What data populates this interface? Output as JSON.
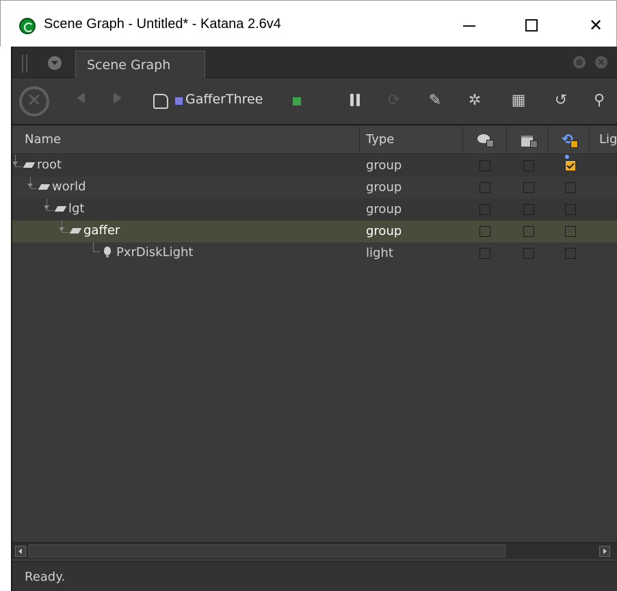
{
  "window": {
    "title": "Scene Graph - Untitled* - Katana 2.6v4",
    "minimize_icon": "minimize-icon",
    "maximize_icon": "maximize-icon",
    "close_glyph": "✕"
  },
  "panel": {
    "tab_label": "Scene Graph"
  },
  "toolbar": {
    "node_name": "GafferThree",
    "stop_glyph": "✕",
    "icons": [
      "stop-icon",
      "back-icon",
      "forward-icon",
      "document-icon",
      "pause-icon",
      "refresh-icon",
      "brush-icon",
      "gear-icon",
      "clapper-icon",
      "rotate-icon",
      "search-icon"
    ],
    "glyphs": {
      "refresh": "⟳",
      "brush": "✎",
      "gear": "✲",
      "clap": "▦",
      "rotate": "↺",
      "search": "⚲"
    }
  },
  "table": {
    "columns": {
      "name": "Name",
      "type": "Type",
      "last": "Lig"
    },
    "rows": [
      {
        "name": "root",
        "type": "group",
        "visible": false,
        "render": false,
        "lock": true,
        "selected": false
      },
      {
        "name": "world",
        "type": "group",
        "visible": false,
        "render": false,
        "lock": false,
        "selected": false
      },
      {
        "name": "lgt",
        "type": "group",
        "visible": false,
        "render": false,
        "lock": false,
        "selected": false
      },
      {
        "name": "gaffer",
        "type": "group",
        "visible": false,
        "render": false,
        "lock": false,
        "selected": true
      },
      {
        "name": "PxrDiskLight",
        "type": "light",
        "visible": false,
        "render": false,
        "lock": false,
        "selected": false
      }
    ]
  },
  "status": {
    "text": "Ready."
  },
  "colors": {
    "panel_bg": "#3a3a3a",
    "selected_row": "#4b4b3c",
    "node_blue": "#7b7bdc",
    "node_green": "#3da24a",
    "checked": "#f0b020"
  }
}
